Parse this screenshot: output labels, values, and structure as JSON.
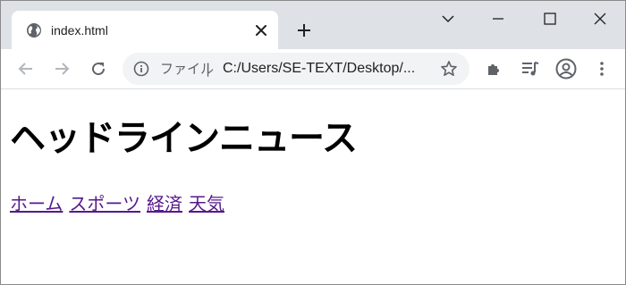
{
  "browser": {
    "tab": {
      "title": "index.html"
    },
    "omnibox": {
      "scheme_label": "ファイル",
      "separator": "|",
      "url": "C:/Users/SE-TEXT/Desktop/..."
    }
  },
  "page": {
    "heading": "ヘッドラインニュース",
    "nav_links": [
      "ホーム",
      "スポーツ",
      "経済",
      "天気"
    ]
  },
  "colors": {
    "tabstrip": "#dee1e6",
    "omnibox": "#f1f3f4",
    "visited_link": "#551a8b",
    "icon": "#5f6368"
  }
}
